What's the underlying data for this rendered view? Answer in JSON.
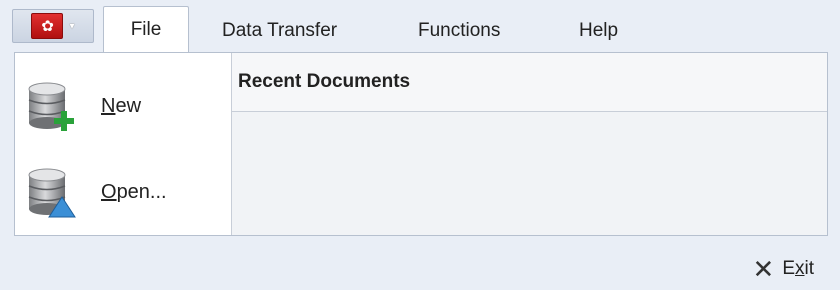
{
  "ribbon": {
    "app_button": {
      "logo": "app-logo-icon",
      "caret": "▾"
    },
    "tabs": [
      {
        "label": "File",
        "active": true
      },
      {
        "label": "Data Transfer",
        "active": false
      },
      {
        "label": "Functions",
        "active": false
      },
      {
        "label": "Help",
        "active": false
      }
    ]
  },
  "file_menu": {
    "items": [
      {
        "label_underline": "N",
        "label_rest": "ew",
        "icon": "database-new-icon"
      },
      {
        "label_underline": "O",
        "label_rest": "pen...",
        "icon": "database-open-icon"
      }
    ],
    "recent_documents_title": "Recent Documents",
    "recent_documents": []
  },
  "footer": {
    "exit_pre": "E",
    "exit_underline": "x",
    "exit_post": "it"
  },
  "colors": {
    "background": "#e9eef6",
    "panel": "#ffffff",
    "recent_area": "#f1f3f6",
    "border": "#b6c0cf",
    "app_button_red": "#d02020"
  }
}
